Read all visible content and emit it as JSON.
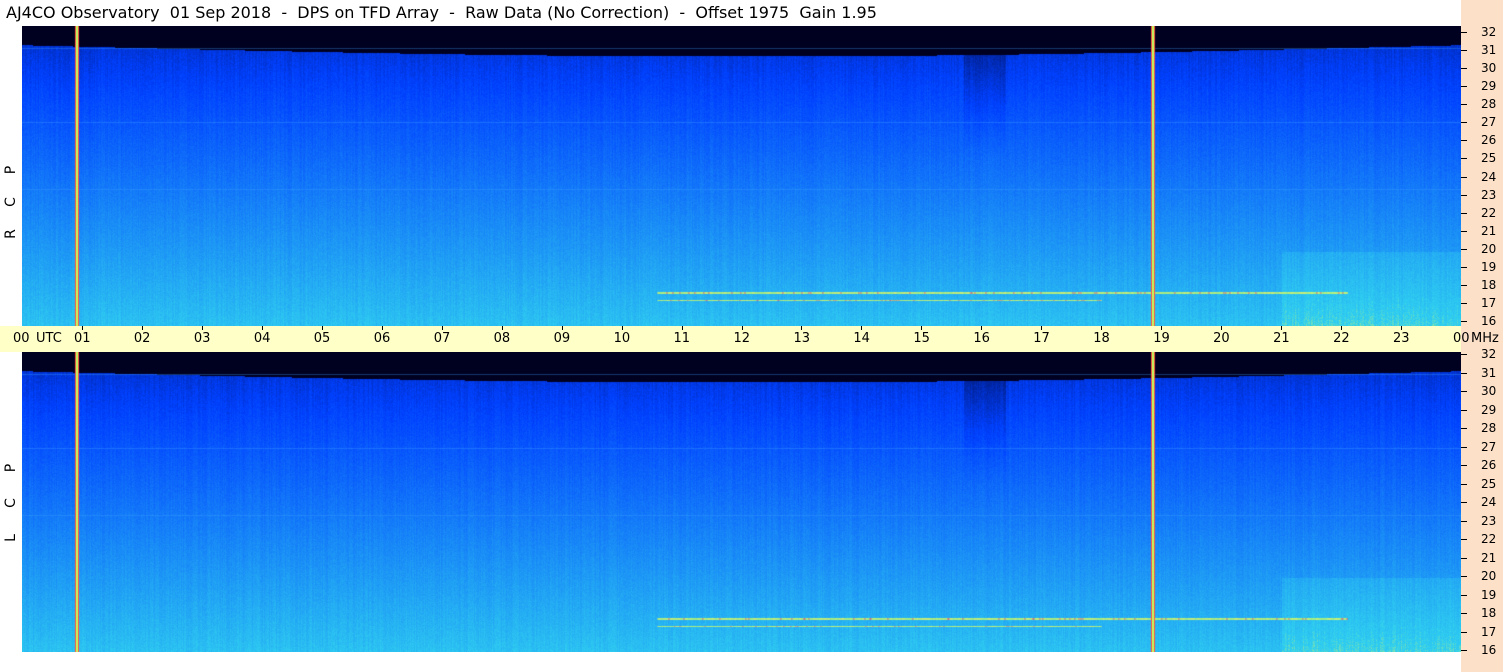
{
  "title": "AJ4CO Observatory  01 Sep 2018  -  DPS on TFD Array  -  Raw Data (No Correction)  -  Offset 1975  Gain 1.95",
  "panels": [
    {
      "letters": [
        "R",
        "C",
        "P"
      ]
    },
    {
      "letters": [
        "L",
        "C",
        "P"
      ]
    }
  ],
  "time_axis": {
    "labels": [
      "00",
      "UTC",
      "01",
      "02",
      "03",
      "04",
      "05",
      "06",
      "07",
      "08",
      "09",
      "10",
      "11",
      "12",
      "13",
      "14",
      "15",
      "16",
      "17",
      "18",
      "19",
      "20",
      "21",
      "22",
      "23",
      "00",
      "MHz"
    ]
  },
  "freq_axis": {
    "labels": [
      "32",
      "31",
      "30",
      "29",
      "28",
      "27",
      "26",
      "25",
      "24",
      "23",
      "22",
      "21",
      "20",
      "19",
      "18",
      "17",
      "16"
    ]
  },
  "colors": {
    "background_strip": "#fce0c8",
    "time_bar": "#ffffc8",
    "low": "#000020",
    "mid": "#0040ff",
    "high": "#30d0f0",
    "hot": "#ffff40"
  },
  "chart_data": {
    "type": "heatmap",
    "title": "AJ4CO Observatory  01 Sep 2018  -  DPS on TFD Array  -  Raw Data (No Correction)  -  Offset 1975  Gain 1.95",
    "x_unit": "UTC",
    "y_unit": "MHz",
    "x_range": [
      0,
      24
    ],
    "y_range": [
      16,
      32
    ],
    "panels": [
      "RCP",
      "LCP"
    ],
    "vertical_lines_utc": [
      0.9,
      18.85
    ],
    "horizontal_lines_mhz": [
      30.8,
      26.9,
      23.3
    ],
    "bright_bands": [
      {
        "freq_mhz": 17.8,
        "start_utc": 10.6,
        "end_utc": 22.1
      },
      {
        "freq_mhz": 17.4,
        "start_utc": 10.6,
        "end_utc": 18.0
      }
    ]
  }
}
